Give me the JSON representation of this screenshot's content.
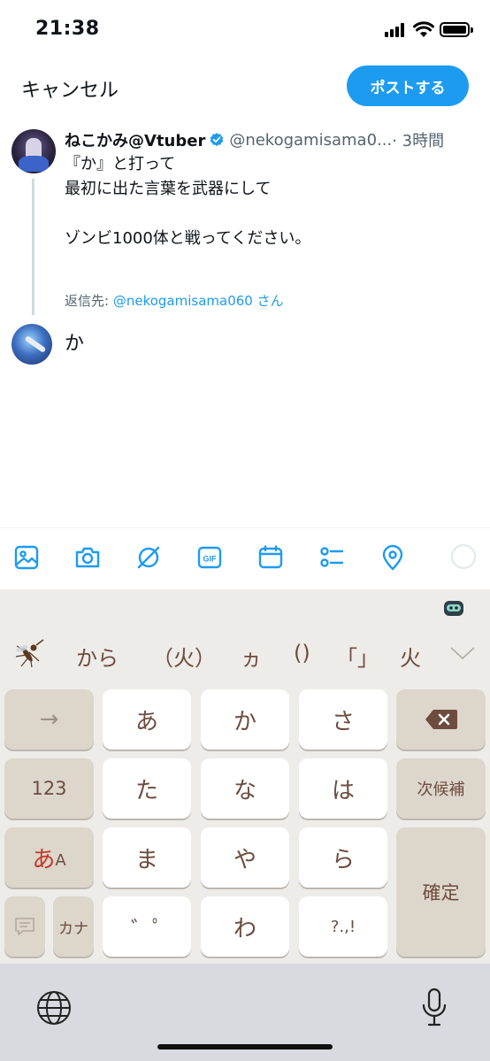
{
  "status_bar": {
    "time": "21:38"
  },
  "header": {
    "cancel_label": "キャンセル",
    "post_label": "ポストする"
  },
  "original_tweet": {
    "display_name": "ねこかみ@Vtuber",
    "handle": "@nekogamisama0...",
    "time": "· 3時間",
    "body_lines": [
      "『か』と打って",
      "最初に出た言葉を武器にして",
      "",
      "ゾンビ1000体と戦ってください。"
    ],
    "reply_to_prefix": "返信先: ",
    "reply_to_handle": "@nekogamisama060 さん"
  },
  "reply": {
    "text": "か"
  },
  "toolbar": {
    "icons": [
      "image-icon",
      "camera-icon",
      "no-entry-icon",
      "gif-icon",
      "calendar-icon",
      "poll-icon",
      "location-icon"
    ],
    "gif_label": "GIF"
  },
  "keyboard": {
    "candidates": [
      "から",
      "（火）",
      "ヵ",
      "()",
      "「」",
      "火"
    ],
    "keys": {
      "arrow": "→",
      "a": "あ",
      "ka": "か",
      "sa": "さ",
      "num": "123",
      "ta": "た",
      "na": "な",
      "ha": "は",
      "next": "次候補",
      "mode_a": "あ",
      "mode_b": "A",
      "ma": "ま",
      "ya": "や",
      "ra": "ら",
      "confirm": "確定",
      "kana": "カナ",
      "dakuten": "゛ﾟ",
      "wa": "わ",
      "punct": "?.,!"
    }
  },
  "colors": {
    "accent": "#1d9bf0",
    "key_text": "#6d4c3f",
    "keyboard_bg": "#eeece8"
  }
}
